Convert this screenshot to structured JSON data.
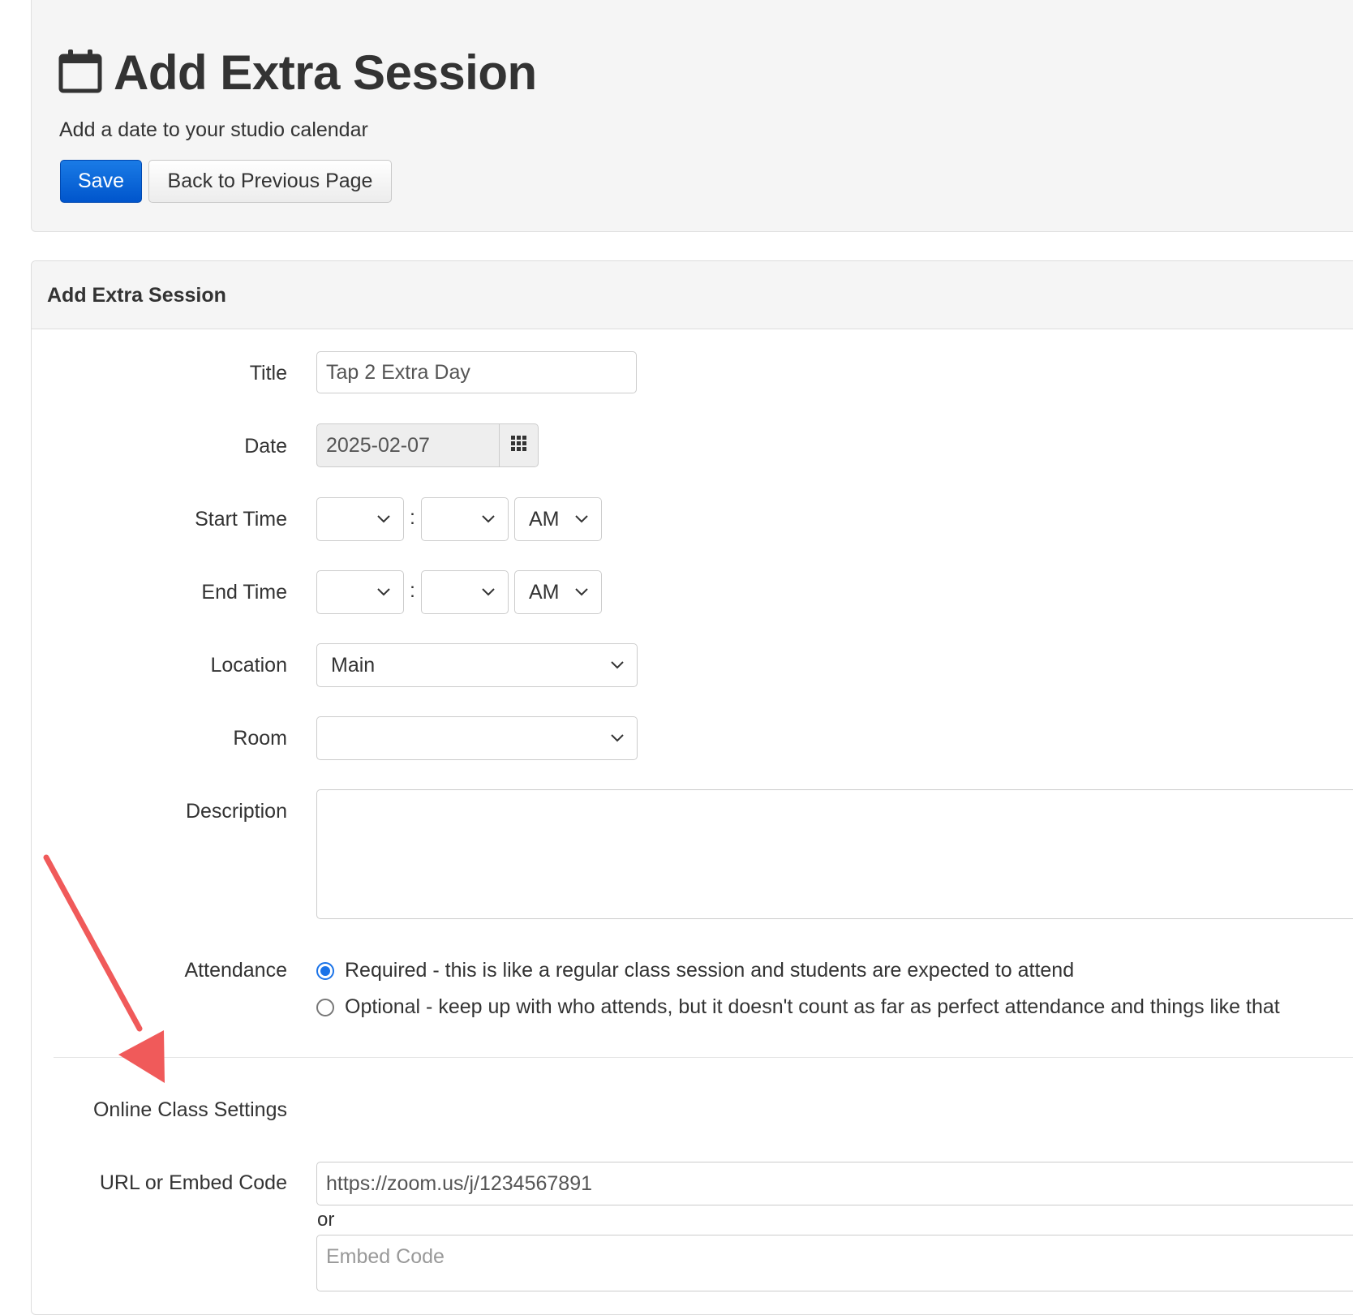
{
  "header": {
    "title": "Add Extra Session",
    "title_icon": "calendar-icon",
    "subtitle": "Add a date to your studio calendar",
    "save_label": "Save",
    "back_label": "Back to Previous Page"
  },
  "form": {
    "panel_title": "Add Extra Session",
    "title": {
      "label": "Title",
      "value": "Tap 2 Extra Day"
    },
    "date": {
      "label": "Date",
      "value": "2025-02-07",
      "picker_icon": "calendar-grid-icon"
    },
    "start_time": {
      "label": "Start Time",
      "hour": "",
      "minute": "",
      "separator": ":",
      "ampm": "AM"
    },
    "end_time": {
      "label": "End Time",
      "hour": "",
      "minute": "",
      "separator": ":",
      "ampm": "AM"
    },
    "location": {
      "label": "Location",
      "value": "Main"
    },
    "room": {
      "label": "Room",
      "value": ""
    },
    "description": {
      "label": "Description",
      "value": ""
    },
    "attendance": {
      "label": "Attendance",
      "options": [
        {
          "text": "Required - this is like a regular class session and students are expected to attend",
          "checked": true
        },
        {
          "text": "Optional - keep up with who attends, but it doesn't count as far as perfect attendance and things like that",
          "checked": false
        }
      ]
    },
    "online": {
      "section_label": "Online Class Settings",
      "url_label": "URL or Embed Code",
      "url_value": "https://zoom.us/j/1234567891",
      "or_text": "or",
      "embed_placeholder": "Embed Code"
    }
  },
  "annotation": {
    "arrow_color": "#f05a5a"
  },
  "colors": {
    "primary": "#0066dd",
    "radio_accent": "#1a73e8"
  }
}
